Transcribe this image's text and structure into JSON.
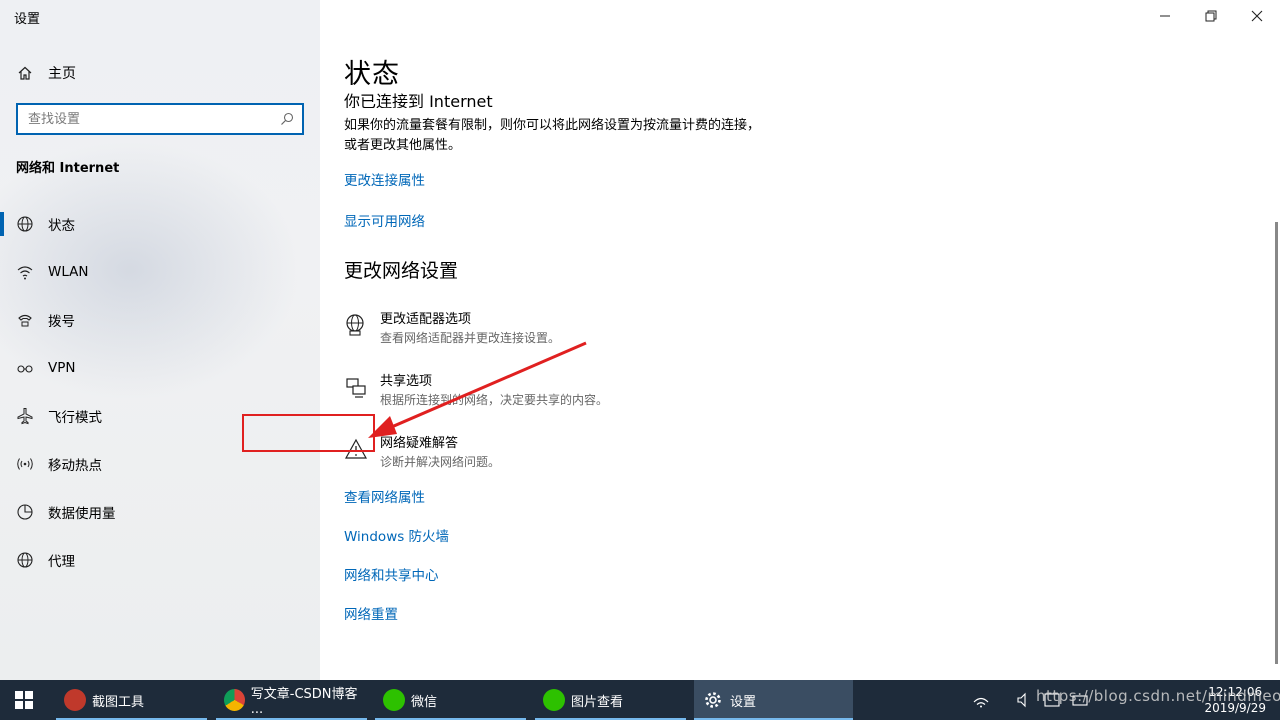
{
  "window": {
    "title": "设置"
  },
  "sidebar": {
    "home_label": "主页",
    "search_placeholder": "查找设置",
    "section_title": "网络和 Internet",
    "items": [
      {
        "label": "状态",
        "icon": "globe-status-icon",
        "active": true
      },
      {
        "label": "WLAN",
        "icon": "wifi-icon"
      },
      {
        "label": "拨号",
        "icon": "dialup-icon"
      },
      {
        "label": "VPN",
        "icon": "vpn-icon"
      },
      {
        "label": "飞行模式",
        "icon": "airplane-icon"
      },
      {
        "label": "移动热点",
        "icon": "hotspot-icon"
      },
      {
        "label": "数据使用量",
        "icon": "data-usage-icon"
      },
      {
        "label": "代理",
        "icon": "proxy-globe-icon"
      }
    ]
  },
  "main": {
    "page_title": "状态",
    "connected_text": "你已连接到 Internet",
    "info_text": "如果你的流量套餐有限制，则你可以将此网络设置为按流量计费的连接，或者更改其他属性。",
    "links_top": [
      "更改连接属性",
      "显示可用网络"
    ],
    "section_heading": "更改网络设置",
    "options": [
      {
        "title": "更改适配器选项",
        "desc": "查看网络适配器并更改连接设置。",
        "icon": "adapter-globe-icon"
      },
      {
        "title": "共享选项",
        "desc": "根据所连接到的网络，决定要共享的内容。",
        "icon": "sharing-icon"
      },
      {
        "title": "网络疑难解答",
        "desc": "诊断并解决网络问题。",
        "icon": "warning-icon"
      }
    ],
    "links_bottom": [
      "查看网络属性",
      "Windows 防火墙",
      "网络和共享中心",
      "网络重置"
    ]
  },
  "taskbar": {
    "apps": [
      {
        "label": "截图工具",
        "icon": "snipping-tool-icon"
      },
      {
        "label": "写文章-CSDN博客 ...",
        "icon": "chrome-icon"
      },
      {
        "label": "微信",
        "icon": "wechat-icon"
      },
      {
        "label": "图片查看",
        "icon": "wechat-icon"
      },
      {
        "label": "设置",
        "icon": "gear-icon",
        "active": true
      }
    ],
    "clock_time": "12:12:06",
    "clock_date": "2019/9/29",
    "watermark": "https://blog.csdn.net/mindmeoix"
  },
  "colors": {
    "accent": "#0063b1",
    "link": "#0067b8",
    "taskbar": "#1e2b3a",
    "annotation": "#e02020"
  }
}
